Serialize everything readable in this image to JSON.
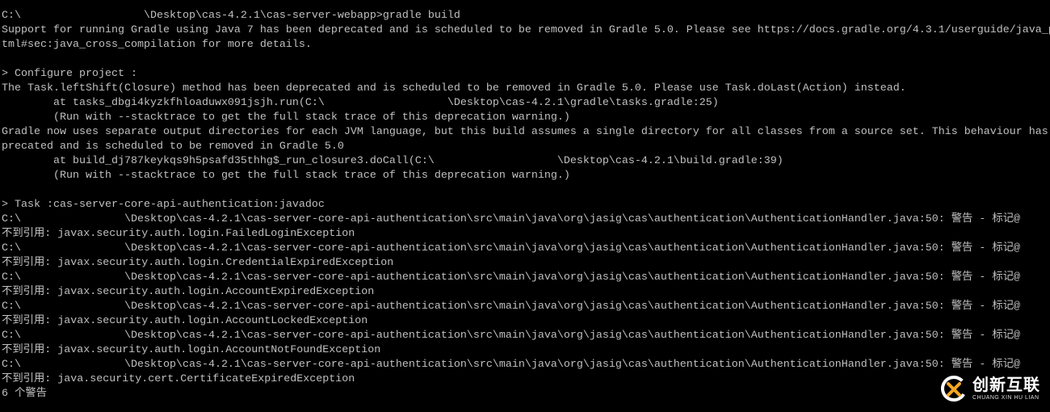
{
  "console": {
    "lines": [
      "C:\\                   \\Desktop\\cas-4.2.1\\cas-server-webapp>gradle build",
      "Support for running Gradle using Java 7 has been deprecated and is scheduled to be removed in Gradle 5.0. Please see https://docs.gradle.org/4.3.1/userguide/java_p",
      "tml#sec:java_cross_compilation for more details.",
      "",
      "> Configure project :",
      "The Task.leftShift(Closure) method has been deprecated and is scheduled to be removed in Gradle 5.0. Please use Task.doLast(Action) instead.",
      "        at tasks_dbgi4kyzkfhloaduwx091jsjh.run(C:\\                   \\Desktop\\cas-4.2.1\\gradle\\tasks.gradle:25)",
      "        (Run with --stacktrace to get the full stack trace of this deprecation warning.)",
      "Gradle now uses separate output directories for each JVM language, but this build assumes a single directory for all classes from a source set. This behaviour has",
      "precated and is scheduled to be removed in Gradle 5.0",
      "        at build_dj787keykqs9h5psafd35thhg$_run_closure3.doCall(C:\\                   \\Desktop\\cas-4.2.1\\build.gradle:39)",
      "        (Run with --stacktrace to get the full stack trace of this deprecation warning.)",
      "",
      "> Task :cas-server-core-api-authentication:javadoc",
      "C:\\                \\Desktop\\cas-4.2.1\\cas-server-core-api-authentication\\src\\main\\java\\org\\jasig\\cas\\authentication\\AuthenticationHandler.java:50: 警告 - 标记@",
      "不到引用: javax.security.auth.login.FailedLoginException",
      "C:\\                \\Desktop\\cas-4.2.1\\cas-server-core-api-authentication\\src\\main\\java\\org\\jasig\\cas\\authentication\\AuthenticationHandler.java:50: 警告 - 标记@",
      "不到引用: javax.security.auth.login.CredentialExpiredException",
      "C:\\                \\Desktop\\cas-4.2.1\\cas-server-core-api-authentication\\src\\main\\java\\org\\jasig\\cas\\authentication\\AuthenticationHandler.java:50: 警告 - 标记@",
      "不到引用: javax.security.auth.login.AccountExpiredException",
      "C:\\                \\Desktop\\cas-4.2.1\\cas-server-core-api-authentication\\src\\main\\java\\org\\jasig\\cas\\authentication\\AuthenticationHandler.java:50: 警告 - 标记@",
      "不到引用: javax.security.auth.login.AccountLockedException",
      "C:\\                \\Desktop\\cas-4.2.1\\cas-server-core-api-authentication\\src\\main\\java\\org\\jasig\\cas\\authentication\\AuthenticationHandler.java:50: 警告 - 标记@",
      "不到引用: javax.security.auth.login.AccountNotFoundException",
      "C:\\                \\Desktop\\cas-4.2.1\\cas-server-core-api-authentication\\src\\main\\java\\org\\jasig\\cas\\authentication\\AuthenticationHandler.java:50: 警告 - 标记@",
      "不到引用: java.security.cert.CertificateExpiredException",
      "6 个警告"
    ]
  },
  "watermark": {
    "title": "创新互联",
    "subtitle": "CHUANG XIN HU LIAN",
    "accent_color": "#f5a623"
  },
  "colors": {
    "background": "#000000",
    "text": "#c0c0c0"
  }
}
